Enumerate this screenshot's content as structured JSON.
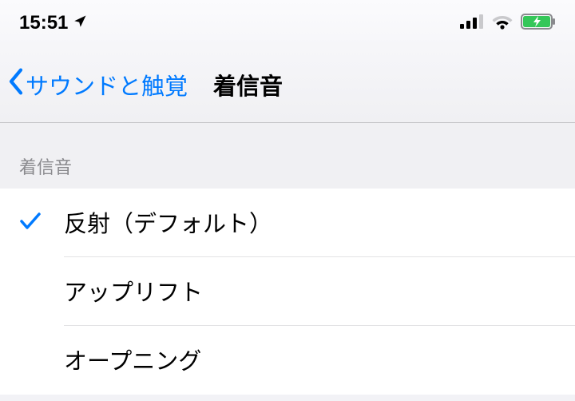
{
  "status": {
    "time": "15:51"
  },
  "nav": {
    "back_label": "サウンドと触覚",
    "title": "着信音"
  },
  "section": {
    "header": "着信音"
  },
  "ringtones": [
    {
      "label": "反射（デフォルト）",
      "selected": true
    },
    {
      "label": "アップリフト",
      "selected": false
    },
    {
      "label": "オープニング",
      "selected": false
    }
  ]
}
